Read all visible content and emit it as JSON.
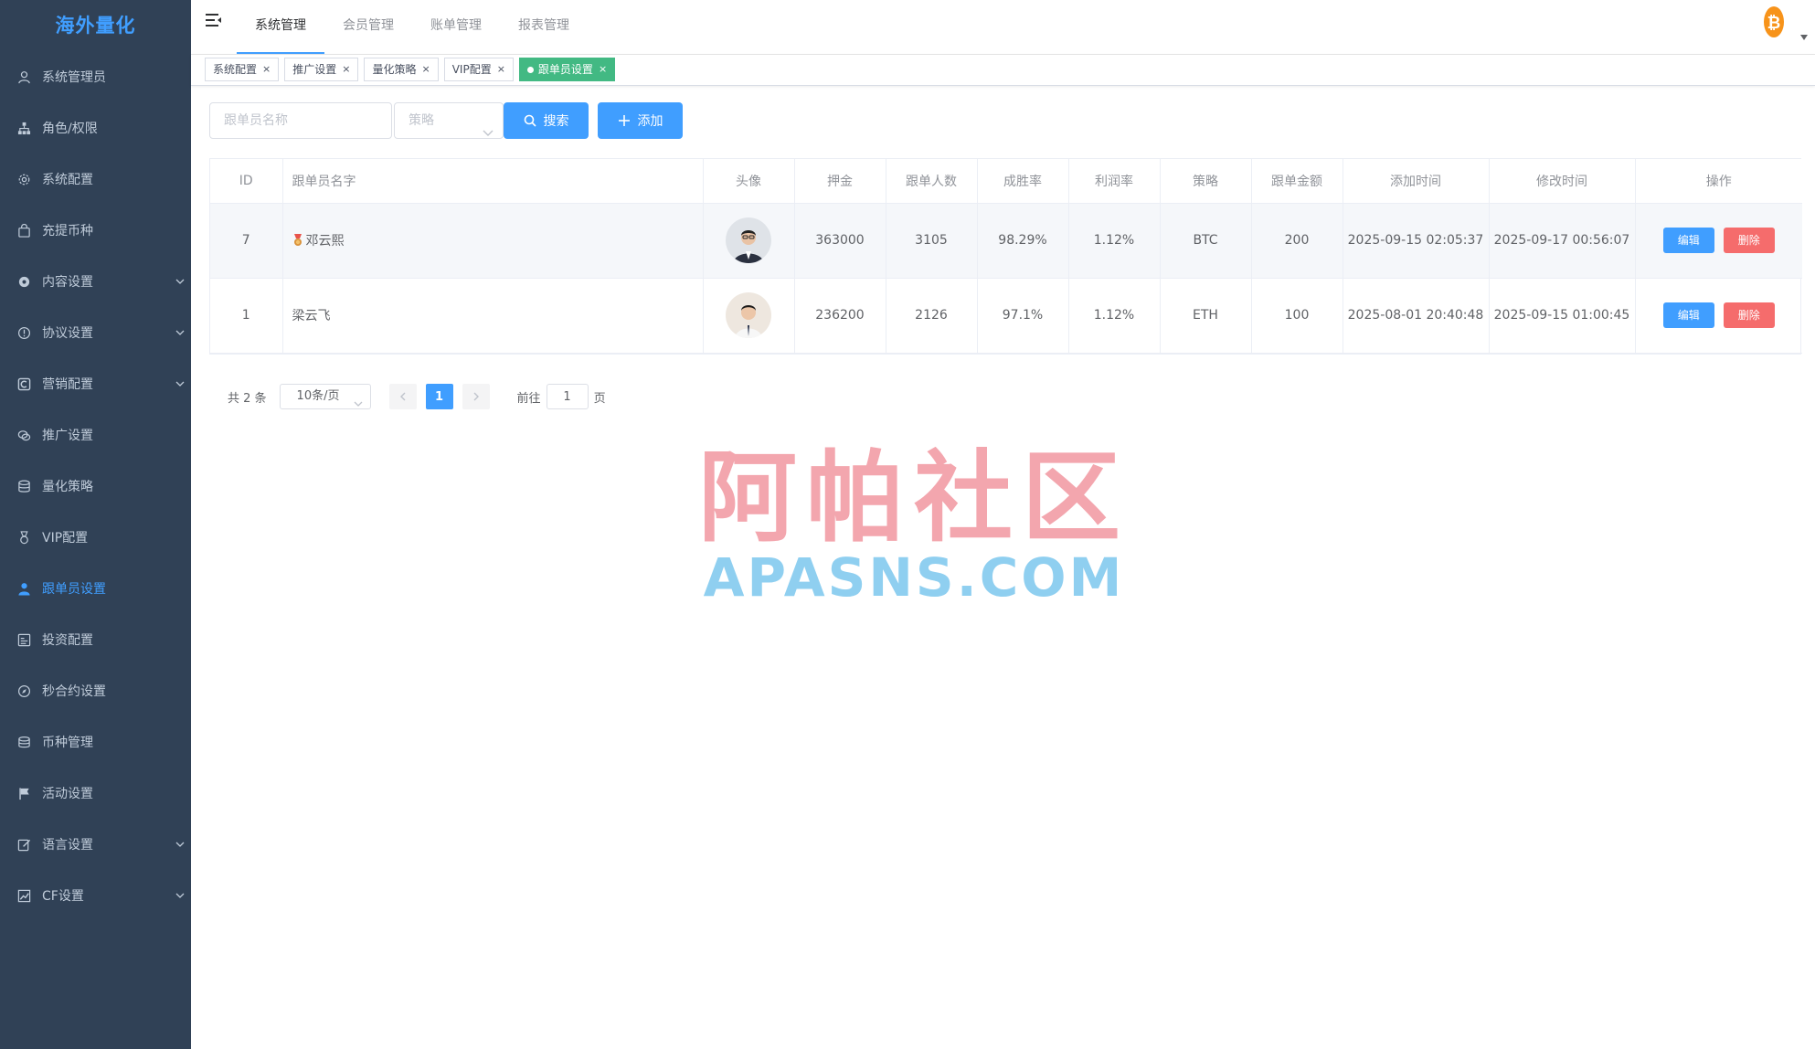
{
  "app": {
    "logo": "海外量化"
  },
  "sidebar": {
    "items": [
      {
        "label": "系统管理员",
        "icon": "user-icon",
        "active": false,
        "expandable": false
      },
      {
        "label": "角色/权限",
        "icon": "org-tree-icon",
        "active": false,
        "expandable": false
      },
      {
        "label": "系统配置",
        "icon": "gear-icon",
        "active": false,
        "expandable": false
      },
      {
        "label": "充提币种",
        "icon": "bag-icon",
        "active": false,
        "expandable": false
      },
      {
        "label": "内容设置",
        "icon": "gear-filled-icon",
        "active": false,
        "expandable": true
      },
      {
        "label": "协议设置",
        "icon": "info-circle-icon",
        "active": false,
        "expandable": true
      },
      {
        "label": "营销配置",
        "icon": "marketing-icon",
        "active": false,
        "expandable": true
      },
      {
        "label": "推广设置",
        "icon": "chat-icon",
        "active": false,
        "expandable": false
      },
      {
        "label": "量化策略",
        "icon": "database-icon",
        "active": false,
        "expandable": false
      },
      {
        "label": "VIP配置",
        "icon": "medal-icon",
        "active": false,
        "expandable": false
      },
      {
        "label": "跟单员设置",
        "icon": "person-filled-icon",
        "active": true,
        "expandable": false
      },
      {
        "label": "投资配置",
        "icon": "chart-box-icon",
        "active": false,
        "expandable": false
      },
      {
        "label": "秒合约设置",
        "icon": "compass-icon",
        "active": false,
        "expandable": false
      },
      {
        "label": "币种管理",
        "icon": "coins-icon",
        "active": false,
        "expandable": false
      },
      {
        "label": "活动设置",
        "icon": "flag-icon",
        "active": false,
        "expandable": false
      },
      {
        "label": "语言设置",
        "icon": "edit-icon",
        "active": false,
        "expandable": true
      },
      {
        "label": "CF设置",
        "icon": "trend-chart-icon",
        "active": false,
        "expandable": true
      }
    ]
  },
  "header": {
    "tabs": [
      {
        "label": "系统管理",
        "active": true
      },
      {
        "label": "会员管理",
        "active": false
      },
      {
        "label": "账单管理",
        "active": false
      },
      {
        "label": "报表管理",
        "active": false
      }
    ],
    "avatar_icon": "bitcoin-icon",
    "colors": {
      "accent": "#409eff",
      "btc": "#f7931a"
    }
  },
  "tags_view": {
    "tags": [
      {
        "label": "系统配置",
        "active": false
      },
      {
        "label": "推广设置",
        "active": false
      },
      {
        "label": "量化策略",
        "active": false
      },
      {
        "label": "VIP配置",
        "active": false
      },
      {
        "label": "跟单员设置",
        "active": true
      }
    ],
    "close_glyph": "×"
  },
  "filter": {
    "name_placeholder": "跟单员名称",
    "name_value": "",
    "strategy_placeholder": "策略",
    "search_label": "搜索",
    "add_label": "添加"
  },
  "table": {
    "columns": [
      "ID",
      "跟单员名字",
      "头像",
      "押金",
      "跟单人数",
      "成胜率",
      "利润率",
      "策略",
      "跟单金额",
      "添加时间",
      "修改时间",
      "操作"
    ],
    "rows": [
      {
        "id": "7",
        "name": "邓云熙",
        "has_medal": true,
        "avatar": "avatar-dark-suit",
        "deposit": "363000",
        "followers": "3105",
        "win_rate": "98.29%",
        "profit_rate": "1.12%",
        "strategy": "BTC",
        "amount": "200",
        "created": "2025-09-15 02:05:37",
        "updated": "2025-09-17 00:56:07",
        "edit_label": "编辑",
        "delete_label": "删除"
      },
      {
        "id": "1",
        "name": "梁云飞",
        "has_medal": false,
        "avatar": "avatar-white-shirt",
        "deposit": "236200",
        "followers": "2126",
        "win_rate": "97.1%",
        "profit_rate": "1.12%",
        "strategy": "ETH",
        "amount": "100",
        "created": "2025-08-01 20:40:48",
        "updated": "2025-09-15 01:00:45",
        "edit_label": "编辑",
        "delete_label": "删除"
      }
    ]
  },
  "pagination": {
    "total_text": "共 2 条",
    "page_size": "10条/页",
    "current_page": "1",
    "goto_prefix": "前往",
    "goto_value": "1",
    "goto_suffix": "页"
  },
  "watermark": {
    "cn": "阿帕社区",
    "en": "APASNS.COM"
  }
}
